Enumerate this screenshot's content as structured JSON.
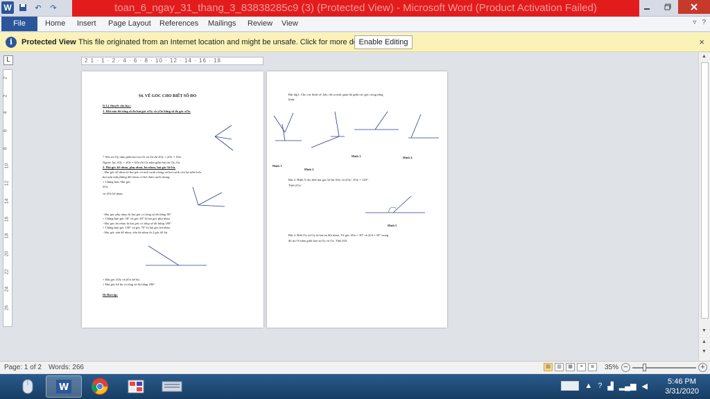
{
  "window": {
    "title": "toan_6_ngay_31_thang_3_83838285c9 (3) (Protected View)  -  Microsoft Word (Product Activation Failed)"
  },
  "qat": {
    "undo": "↶",
    "redo": "↷"
  },
  "ribbon": {
    "tabs": [
      "File",
      "Home",
      "Insert",
      "Page Layout",
      "References",
      "Mailings",
      "Review",
      "View"
    ]
  },
  "protected_view": {
    "title": "Protected View",
    "message": "This file originated from an Internet location and might be unsafe. Click for more details.",
    "button": "Enable Editing",
    "close": "×"
  },
  "ruler": {
    "corner": "L",
    "marks": "2 1 · 1 · 2 · 4 · 6 · 8 · 10 · 12 · 14 · 16 · 18",
    "vmarks": [
      "2",
      "2",
      "4",
      "6",
      "8",
      "10",
      "12",
      "14",
      "16",
      "18",
      "20",
      "22",
      "24",
      "26"
    ]
  },
  "page1": {
    "heading": "§4. VẼ GÓC CHO BIẾT SỐ ĐO",
    "s1": "I) Lý thuyết cần học:",
    "s1_1": "1. Khi nào thì tổng số đo hai góc xOy và yOz bằng số đo góc xOz.",
    "note1": "* Nếu tia Oy nằm giữa hai tia Ox và Oz thì x̂Oy + ŷOz = x̂Oz.",
    "note2": "Ngược lại, x̂Oy + ŷOz = x̂Oz thì Oy nằm giữa hai tia Ox, Oz.",
    "s2": "2. Hai góc kề nhau, phụ nhau, bù nhau, hai góc kề bù.",
    "s2a": "- Hai góc kề nhau là hai góc có một cạnh chung và hai cạnh còn lại nằm trên",
    "s2b": "hai nửa mặt phẳng đối nhau có bờ chứa cạnh chung.",
    "s2c": "+  Chẳng  hạn:  Hai  góc",
    "s2d": "x̂Oy",
    "s2e": "và ŷOz kề nhau",
    "p1": "- Hai góc phụ nhau là hai góc có tổng số đo bằng 90°",
    "p2": "+ Chẳng hạn góc 50° và góc 40° là hai góc phụ nhau",
    "p3": "- Hai góc bù nhau là hai góc có tổng số đo bằng 180°",
    "p4": "+ Chẳng hạn góc 130° và góc 70° là hai góc bù nhau.",
    "p5": "- Hai góc vừa kề nhau, vừa bù nhau là 2 góc kề bù.",
    "k1": "+ Hai góc x̂Oy và ŷOz kề bù.",
    "k2": "+ Hai góc kề bù có tổng số đo bằng 180°",
    "s3": "II) Bài tập:"
  },
  "page2": {
    "b1a": "Bài tập1:  Cho  các  hình  vẽ,  hãy  chỉ  ra  mối  quan  hệ  giữa  các  góc  trong  từng",
    "b1b": "hình.",
    "h1": "Hình 1",
    "h2": "Hình 2",
    "h3": "Hình 3",
    "h4": "Hình 4",
    "b2a": "Bài 2:  Hình 5 cho biết hai góc kề bù x̂Oy và ŷOy', x̂Oy = 120°.",
    "b2b": "Tính ŷOy'",
    "h5": "Hình 5",
    "b3a": "Bài 3: Biết Ox và Oy là hai tia đối nhau. Vẽ góc x̂Oz = 30° và ŷOt = 50° trong",
    "b3b": "đó tia Ot nằm giữa hai tia Oy và Oz. Tính ẑOt."
  },
  "status": {
    "page": "Page: 1 of 2",
    "words": "Words: 266",
    "zoom": "35%"
  },
  "taskbar": {
    "time": "5:46 PM",
    "date": "3/31/2020"
  }
}
